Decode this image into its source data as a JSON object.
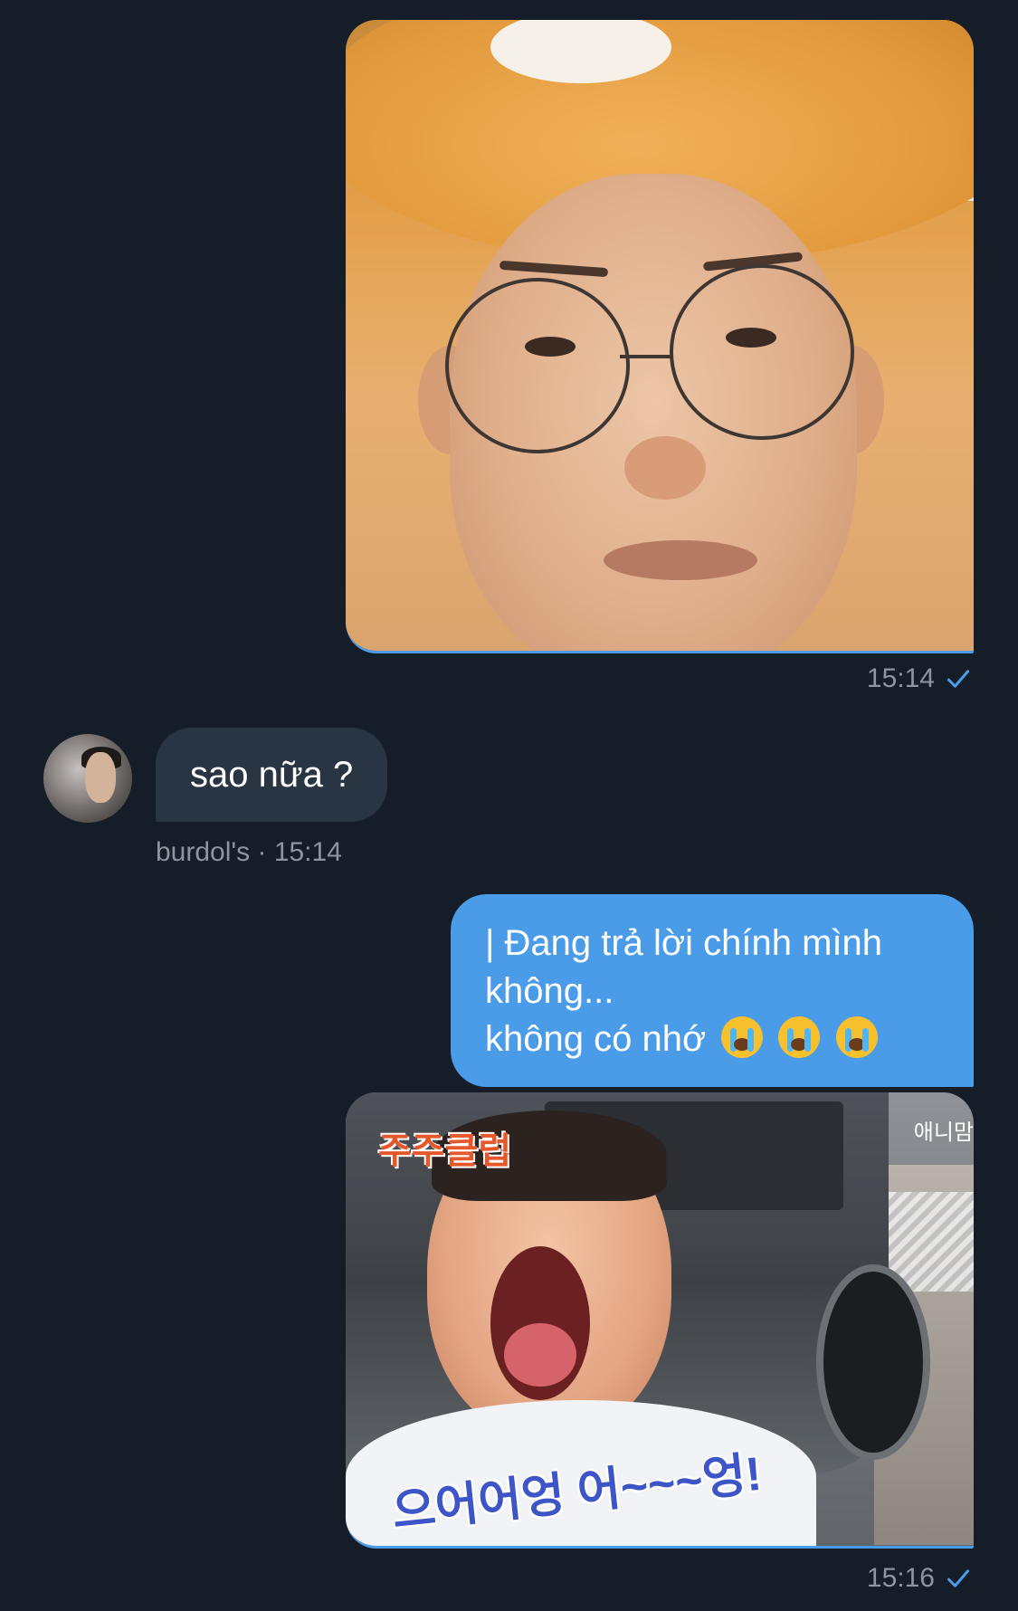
{
  "messages": {
    "photo_message_1": {
      "time": "15:14",
      "status_icon": "check-icon",
      "image": "photo-orange-hat-glasses"
    },
    "received_message": {
      "text": "sao nữa ?",
      "sender": "burdol's",
      "separator": "·",
      "time": "15:14",
      "avatar": "avatar-photo"
    },
    "sent_message": {
      "lines": [
        "| Đang trả lời chính mình",
        "không...",
        "không có nhớ"
      ],
      "emoji": "loudly-crying-face-icon",
      "emoji_count": 3
    },
    "photo_message_2": {
      "time": "15:16",
      "status_icon": "check-icon",
      "image": "photo-crying-child",
      "logo_text": "주주클럽",
      "watermark": "애니맘",
      "caption": "으어어엉 어~~~엉!"
    }
  },
  "colors": {
    "background": "#151d29",
    "sent_bubble": "#4a9be8",
    "received_bubble": "#2a3544",
    "meta_text": "#8d95a1",
    "check": "#4a9be8"
  }
}
